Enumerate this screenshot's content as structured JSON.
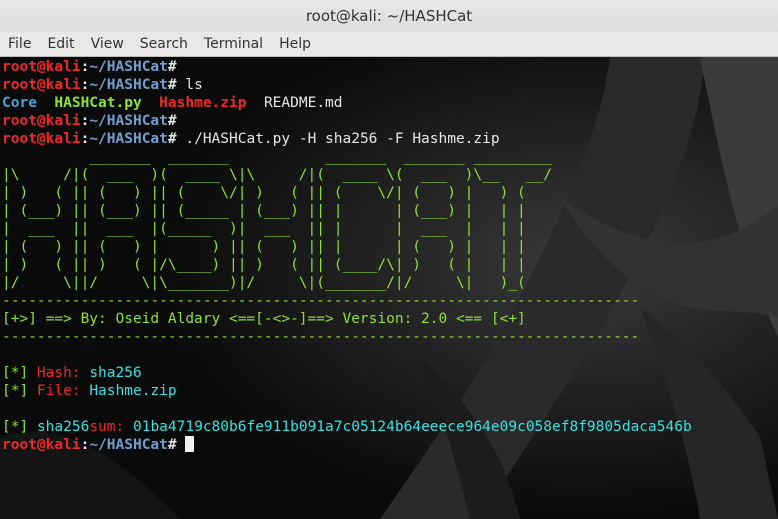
{
  "window": {
    "title": "root@kali: ~/HASHCat"
  },
  "menu": [
    "File",
    "Edit",
    "View",
    "Search",
    "Terminal",
    "Help"
  ],
  "prompt": {
    "user": "root@kali",
    "sep": ":",
    "path": "~/HASHCat",
    "symbol": "#"
  },
  "commands": {
    "ls": " ls",
    "run": " ./HASHCat.py -H sha256 -F Hashme.zip"
  },
  "ls_output": {
    "dir": "Core",
    "py": "HASHCat.py",
    "zip": "Hashme.zip",
    "md": "README.md"
  },
  "banner": [
    "          _______  _______           _______  _______ _________",
    "|\\     /|(  ___  )(  ____ \\|\\     /|(  ____ \\(  ___  )\\__   __/",
    "| )   ( || (   ) || (    \\/| )   ( || (    \\/| (   ) |   ) (   ",
    "| (___) || (___) || (_____ | (___) || |      | (___) |   | |   ",
    "|  ___  ||  ___  |(_____  )|  ___  || |      |  ___  |   | |   ",
    "| (   ) || (   ) |      ) || (   ) || |      | (   ) |   | |   ",
    "| )   ( || )   ( |/\\____) || )   ( || (____/\\| )   ( |   | |   ",
    "|/     \\||/     \\|\\_______)|/     \\|(_______/|/     \\|   )_(   "
  ],
  "rule": "-------------------------------------------------------------------------",
  "credit": "[+>] ==> By: Oseid Aldary <==[-<>-]==> Version: 2.0 <== [<+]",
  "info": {
    "marker": "[*]",
    "hash_label": " Hash: ",
    "hash_value": "sha256",
    "file_label": " File: ",
    "file_value": "Hashme.zip",
    "sum_algo": "sha256",
    "sum_word": "sum: ",
    "sum_value": "01ba4719c80b6fe911b091a7c05124b64eeece964e09c058ef8f9805daca546b"
  }
}
